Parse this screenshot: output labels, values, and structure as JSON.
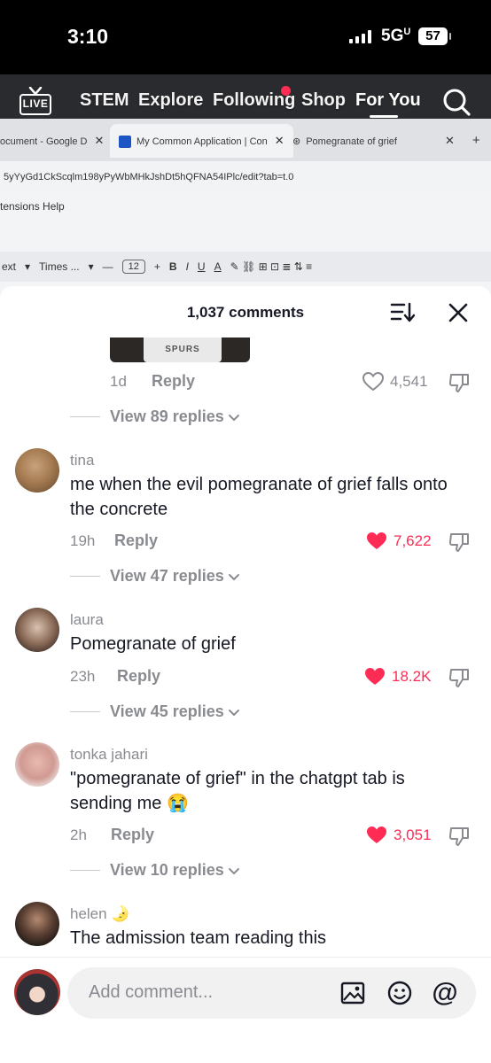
{
  "status_bar": {
    "time": "3:10",
    "network": "5G",
    "battery": "57"
  },
  "video_bg": {
    "tabs": [
      "ocument - Google D",
      "My Common Application | Con",
      "Pomegranate of grief"
    ],
    "url": "5yYyGd1CkScqlm198yPyWbMHkJshDt5hQFNA54IPlc/edit?tab=t.0",
    "menu": "tensions   Help",
    "toolbar": {
      "style": "ext",
      "font": "Times ...",
      "size": "12",
      "buttons": [
        "B",
        "I",
        "U",
        "A"
      ]
    }
  },
  "top_nav": {
    "live_label": "LIVE",
    "items": [
      "STEM",
      "Explore",
      "Following",
      "Shop",
      "For You"
    ],
    "active": "For You"
  },
  "comments_sheet": {
    "count_label": "1,037 comments",
    "first": {
      "shirt_text": "SPURS",
      "time": "1d",
      "reply": "Reply",
      "likes": "4,541",
      "view_replies": "View 89 replies"
    },
    "comments": [
      {
        "user": "tina",
        "text": "me when the evil pomegranate of grief falls onto the concrete",
        "time": "19h",
        "reply": "Reply",
        "likes": "7,622",
        "liked": true,
        "view_replies": "View 47 replies"
      },
      {
        "user": "laura",
        "text": "Pomegranate of grief",
        "time": "23h",
        "reply": "Reply",
        "likes": "18.2K",
        "liked": true,
        "view_replies": "View 45 replies"
      },
      {
        "user": "tonka jahari",
        "text": "\"pomegranate of grief\" in the chatgpt tab is sending me 😭",
        "time": "2h",
        "reply": "Reply",
        "likes": "3,051",
        "liked": true,
        "view_replies": "View 10 replies"
      },
      {
        "user": "helen 🌛",
        "text": "The admission team reading this"
      }
    ],
    "composer": {
      "placeholder": "Add comment...",
      "at": "@"
    }
  },
  "colors": {
    "accent": "#fe2c55",
    "muted": "#8a8b91",
    "text": "#161823"
  }
}
